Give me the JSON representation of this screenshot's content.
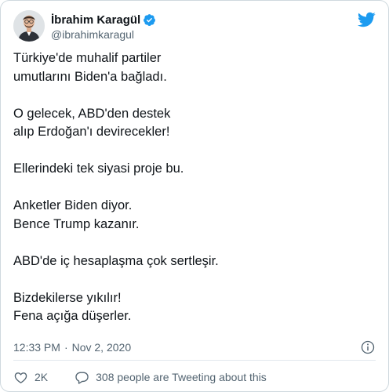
{
  "tweet": {
    "author": {
      "display_name": "İbrahim Karagül",
      "handle": "@ibrahimkaragul",
      "verified": true
    },
    "text_paragraphs": [
      [
        "Türkiye'de muhalif partiler",
        "umutlarını Biden'a bağladı."
      ],
      [
        "O gelecek, ABD'den destek",
        "alıp Erdoğan'ı devirecekler!"
      ],
      [
        "Ellerindeki tek siyasi proje bu."
      ],
      [
        "Anketler Biden diyor.",
        "Bence Trump kazanır."
      ],
      [
        "ABD'de iç hesaplaşma çok sertleşir."
      ],
      [
        "Bizdekilerse yıkılır!",
        "Fena açığa düşerler."
      ]
    ],
    "time": "12:33 PM",
    "separator": "·",
    "date": "Nov 2, 2020",
    "likes": "2K",
    "conversation_label": "308 people are Tweeting about this"
  },
  "icons": {
    "brand": "twitter-bird-icon",
    "verified": "verified-badge-icon",
    "info": "info-icon",
    "like": "heart-icon",
    "comment": "speech-bubble-icon"
  },
  "colors": {
    "brand_blue": "#1d9bf0",
    "text": "#0f1419",
    "secondary_text": "#536471",
    "border": "#cfd9de"
  }
}
